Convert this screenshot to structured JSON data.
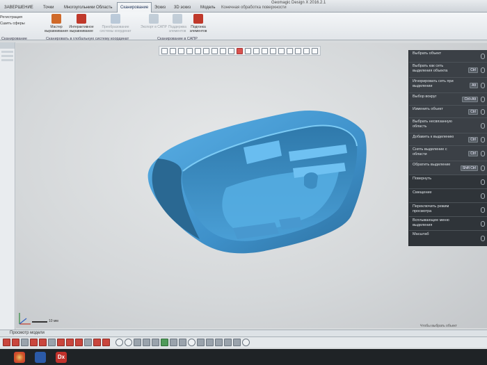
{
  "app": {
    "title": "Geomagic Design X 2016.2.1",
    "context_tab": "Конечная обработка поверхности"
  },
  "tabs": [
    {
      "label": "ЗАВЕРШЕНИЕ"
    },
    {
      "label": "Точки"
    },
    {
      "label": "Многоугольники"
    },
    {
      "label": "Область"
    },
    {
      "label": "Сканирование"
    },
    {
      "label": "Эскиз"
    },
    {
      "label": "3D эскиз"
    },
    {
      "label": "Модель"
    }
  ],
  "ribbon": {
    "left_items": [
      "Регистрация",
      "Сшить сферы",
      ""
    ],
    "buttons": [
      {
        "label": "Мастер выравнивания",
        "enabled": true,
        "color": "#d06a2a"
      },
      {
        "label": "Интерактивное выравнивание",
        "enabled": true,
        "color": "#c0392b"
      },
      {
        "label": "Преобразование системы координат",
        "enabled": false,
        "color": "#7a9ab8"
      },
      {
        "label": "Экспорт в САПР",
        "enabled": false,
        "color": "#8aa0b4"
      },
      {
        "label": "Поддержка элементов",
        "enabled": false,
        "color": "#8aa0b4"
      },
      {
        "label": "Подгонка элементов",
        "enabled": true,
        "color": "#c0392b"
      }
    ],
    "group_labels": [
      "Сканирование",
      "Сканировать в глобальную систему координат",
      "Сканирование в САПР"
    ]
  },
  "selection_panel": {
    "rows": [
      {
        "label": "Выбрать объект",
        "key": ""
      },
      {
        "label": "Выбрать как сеть выделения объекта",
        "key": "Ctrl"
      },
      {
        "label": "Игнорировать сеть при выделении",
        "key": "Alt"
      },
      {
        "label": "Выбор вокруг",
        "key": "Ctrl+Alt"
      },
      {
        "label": "Изменить объект",
        "key": "Ctrl"
      },
      {
        "label": "Выбрать несвязанную область",
        "key": ""
      },
      {
        "label": "Добавить к выделению",
        "key": "Ctrl"
      },
      {
        "label": "Снять выделение с области",
        "key": "Ctrl"
      },
      {
        "label": "Обратить выделение",
        "key": "Shift Ctrl"
      },
      {
        "label": "Повернуть",
        "key": ""
      },
      {
        "label": "Смещение",
        "key": ""
      },
      {
        "label": "Переключить режим просмотра",
        "key": ""
      },
      {
        "label": "Всплывающее меню выделения",
        "key": ""
      },
      {
        "label": "Масштаб",
        "key": ""
      }
    ]
  },
  "viewport": {
    "scale_label": "10 мм",
    "status_text": "Чтобы выбрать объект"
  },
  "bottom": {
    "model_tree_label": "Просмотр модели"
  },
  "taskbar": {
    "dx_label": "Dx"
  },
  "colors": {
    "model": "#4a9fd6",
    "model_shadow": "#2a6f9f",
    "panel_bg": "#3b4046",
    "accent": "#c9463d"
  }
}
